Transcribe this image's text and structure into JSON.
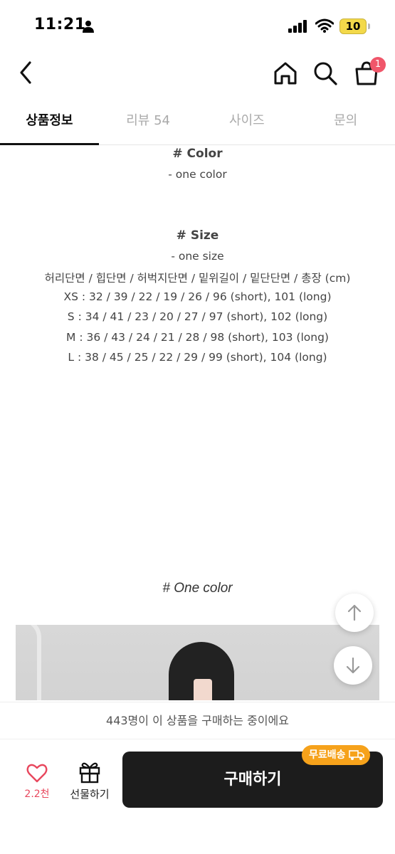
{
  "status": {
    "time": "11:21",
    "battery": "10"
  },
  "cart": {
    "count": "1"
  },
  "tabs": [
    {
      "label": "상품정보"
    },
    {
      "label": "리뷰 54"
    },
    {
      "label": "사이즈"
    },
    {
      "label": "문의"
    }
  ],
  "content": {
    "color_title": "# Color",
    "color_value": "- one color",
    "size_title": "# Size",
    "size_value": "- one size",
    "size_header": "허리단면 / 힙단면 / 허벅지단면 / 밑위길이 / 밑단단면 / 총장 (cm)",
    "size_rows": [
      "XS : 32 / 39 / 22 / 19 / 26 / 96 (short), 101 (long)",
      "S : 34 / 41 / 23 / 20 / 27 / 97 (short), 102 (long)",
      "M : 36 / 43 / 24 / 21 / 28 / 98 (short), 103 (long)",
      "L : 38 / 45 / 25 / 22 / 29 / 99 (short), 104 (long)"
    ],
    "one_color_heading": "# One color"
  },
  "bottom": {
    "buying_now": "443명이 이 상품을 구매하는 중이에요",
    "like_count": "2.2천",
    "gift_label": "선물하기",
    "buy_label": "구매하기",
    "free_shipping": "무료배송"
  },
  "colors": {
    "accent_red": "#e8475d",
    "buy_bg": "#1c1c1c",
    "shipping_badge": "#f6a21b"
  }
}
